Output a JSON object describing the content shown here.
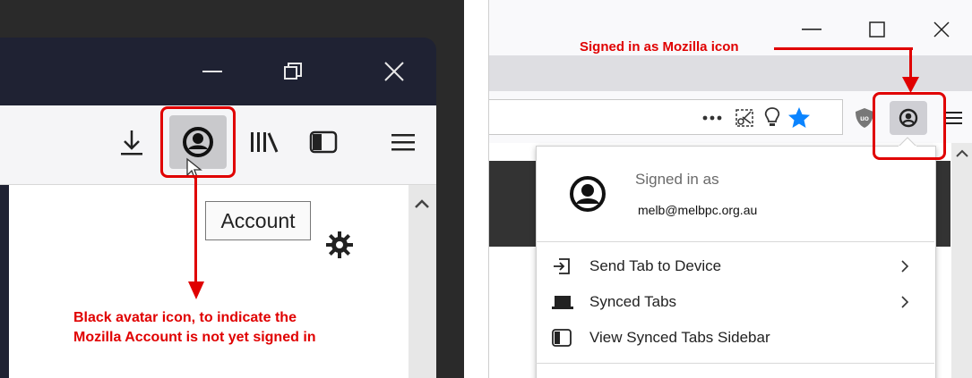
{
  "left_panel": {
    "tooltip": "Account",
    "annotation_line1": "Black avatar icon, to indicate the",
    "annotation_line2": "Mozilla Account is not yet signed in"
  },
  "right_panel": {
    "annotation": "Signed in as Mozilla icon",
    "signed_in_label": "Signed in as",
    "email": "melb@melbpc.org.au",
    "menu": [
      {
        "label": "Send Tab to Device",
        "icon": "send-tab-icon",
        "has_submenu": true
      },
      {
        "label": "Synced Tabs",
        "icon": "laptop-icon",
        "has_submenu": true
      },
      {
        "label": "View Synced Tabs Sidebar",
        "icon": "sidebar-icon",
        "has_submenu": false
      }
    ]
  },
  "colors": {
    "annotation_red": "#e00000",
    "highlight_red": "#e00000",
    "bookmark_star_blue": "#0a84ff",
    "left_window_bg": "#2a2a2a",
    "left_titlebar": "#1f2233",
    "left_toolbar": "#f5f5f7"
  }
}
